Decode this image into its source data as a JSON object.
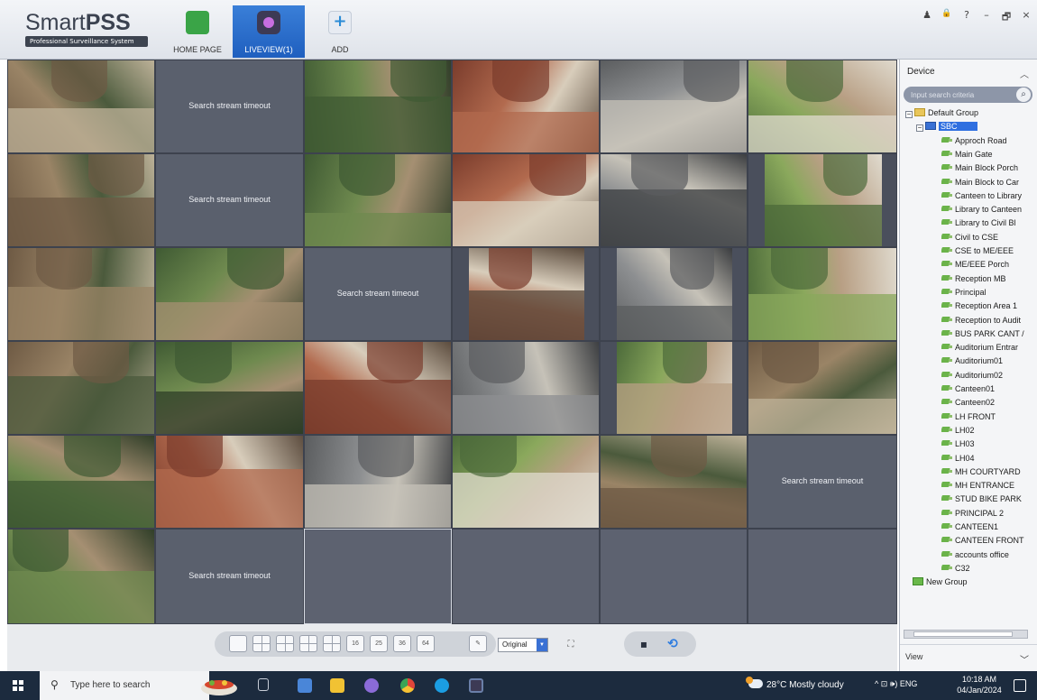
{
  "app": {
    "brand_plain": "Smart",
    "brand_bold": "PSS",
    "tagline": "Professional Surveillance System"
  },
  "nav": {
    "home_label": "HOME PAGE",
    "liveview_label": "LIVEVIEW(1)",
    "add_label": "ADD"
  },
  "window_controls": {
    "user": "♟",
    "lock": "🔒",
    "help": "?",
    "minimize": "–",
    "restore": "🗗",
    "close": "×"
  },
  "grid": {
    "timeout_text": "Search stream timeout"
  },
  "panel": {
    "title": "Device",
    "search_placeholder": "Input search criteria",
    "root_group": "Default Group",
    "device": "SBC",
    "channels": [
      "Approch Road",
      "Main Gate",
      "Main Block Porch",
      "Main Block to Car",
      "Canteen to Library",
      "Library to Canteen",
      "Library to Civil Bl",
      "Civil to CSE",
      "CSE to ME/EEE",
      "ME/EEE Porch",
      "Reception MB",
      "Principal",
      "Reception Area 1",
      "Reception to Audit",
      "BUS PARK CANT /",
      "Auditorium Entrar",
      "Auditorium01",
      "Auditorium02",
      "Canteen01",
      "Canteen02",
      "LH FRONT",
      "LH02",
      "LH03",
      "LH04",
      "MH COURTYARD",
      "MH ENTRANCE",
      "STUD BIKE PARK",
      "PRINCIPAL 2",
      "CANTEEN1",
      "CANTEEN FRONT",
      "accounts office",
      "C32"
    ],
    "new_group": "New Group",
    "footer": "View"
  },
  "toolbar": {
    "layouts": [
      "",
      "",
      "",
      "",
      "",
      "16",
      "25",
      "36",
      "64"
    ],
    "ratio": "Original"
  },
  "taskbar": {
    "search_text": "Type here to search",
    "weather": "28°C  Mostly cloudy",
    "tray": "^  ⊡  🕪)  ENG",
    "time": "10:18 AM",
    "date": "04/Jan/2024"
  }
}
